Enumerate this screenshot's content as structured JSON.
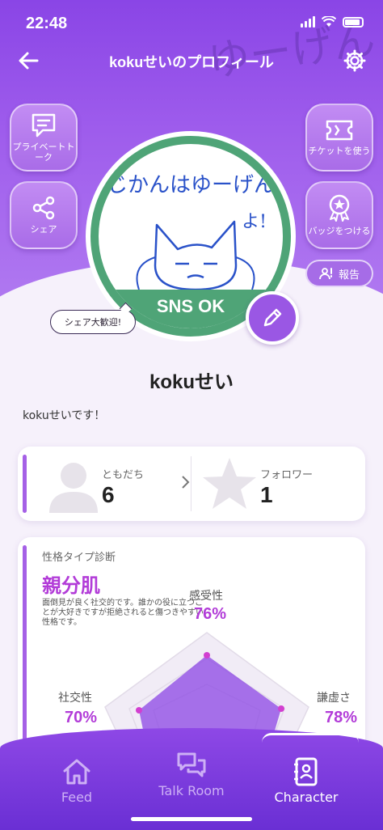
{
  "status_bar": {
    "time": "22:48"
  },
  "nav": {
    "title": "kokuせいのプロフィール"
  },
  "side_buttons": {
    "private_talk": "プライベートトーク",
    "share": "シェア",
    "ticket": "チケットを使う",
    "badge": "バッジをつける",
    "report": "報告"
  },
  "avatar": {
    "drawing_text_line1": "じかんはゆーげん",
    "drawing_text_line2": "よ!",
    "band_text": "SNS OK"
  },
  "share_bubble": "シェア大歓迎!",
  "profile": {
    "username": "kokuせい",
    "bio": "kokuせいです！"
  },
  "stats": {
    "friends_label": "ともだち",
    "friends_value": "6",
    "followers_label": "フォロワー",
    "followers_value": "1"
  },
  "personality": {
    "heading": "性格タイプ診断",
    "type_name": "親分肌",
    "description": "面倒見が良く社交的です。誰かの役に立つことが大好きですが拒絶されると傷つきやすい性格です。",
    "traits": [
      {
        "label": "感受性",
        "value": "76%"
      },
      {
        "label": "社交性",
        "value": "70%"
      },
      {
        "label": "謙虚さ",
        "value": "78%"
      }
    ]
  },
  "tabs": [
    {
      "label": "Feed",
      "icon": "home-icon"
    },
    {
      "label": "Talk Room",
      "icon": "chat-bubbles-icon"
    },
    {
      "label": "Character",
      "icon": "contacts-book-icon"
    }
  ],
  "colors": {
    "accent": "#9a57e4",
    "sns_green": "#4fa477",
    "trait_pink": "#b23cd8"
  }
}
